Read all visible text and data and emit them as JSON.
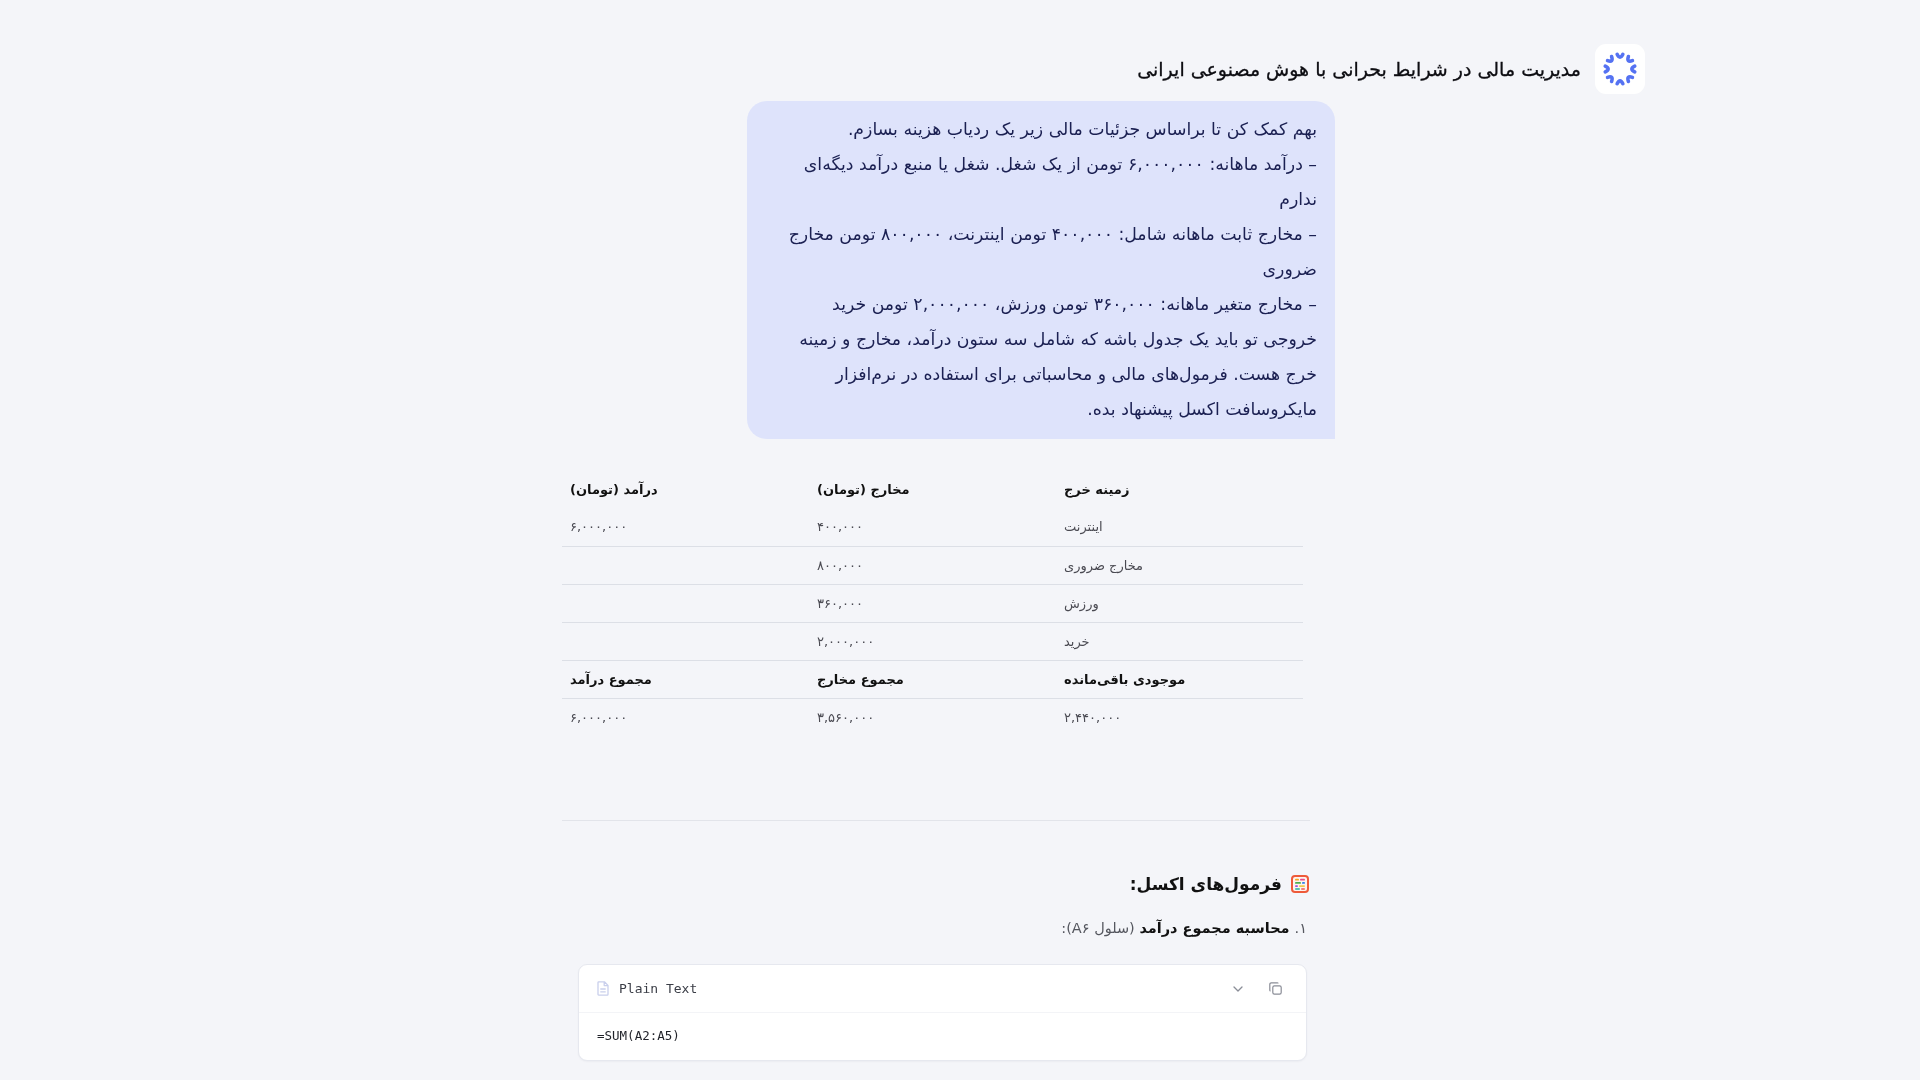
{
  "header": {
    "title": "مدیریت مالی در شرایط بحرانی با هوش مصنوعی ایرانی"
  },
  "user_message": {
    "paragraphs": [
      "بهم کمک کن تا براساس جزئیات مالی زیر یک ردیاب هزینه بسازم.",
      "– درآمد ماهانه: ۶,۰۰۰,۰۰۰ تومن از یک شغل. شغل یا منبع درآمد دیگه‌ای ندارم",
      "– مخارج ثابت ماهانه شامل: ۴۰۰,۰۰۰ تومن اینترنت، ۸۰۰,۰۰۰ تومن مخارج ضروری",
      "– مخارج متغیر ماهانه: ۳۶۰,۰۰۰ تومن ورزش، ۲,۰۰۰,۰۰۰ تومن خرید",
      "خروجی تو باید یک جدول باشه که شامل سه ستون درآمد، مخارج و زمینه خرج هست. فرمول‌های مالی و محاسباتی برای استفاده در نرم‌افزار مایکروسافت اکسل پیشنهاد بده."
    ]
  },
  "table": {
    "columns": [
      "زمینه خرج",
      "مخارج (تومان)",
      "درآمد (تومان)"
    ],
    "rows": [
      {
        "kind": "value",
        "category": "اینترنت",
        "expenses": "۴۰۰,۰۰۰",
        "income": "۶,۰۰۰,۰۰۰"
      },
      {
        "kind": "value",
        "category": "مخارج ضروری",
        "expenses": "۸۰۰,۰۰۰"
      },
      {
        "kind": "value",
        "category": "ورزش",
        "expenses": "۳۶۰,۰۰۰"
      },
      {
        "kind": "value",
        "category": "خرید",
        "expenses": "۲,۰۰۰,۰۰۰"
      },
      {
        "kind": "heading",
        "category": "موجودی باقی‌مانده",
        "expenses": "مجموع مخارج",
        "income": "مجموع درآمد"
      },
      {
        "kind": "value",
        "category": "۲,۴۴۰,۰۰۰",
        "expenses": "۳,۵۶۰,۰۰۰",
        "income": "۶,۰۰۰,۰۰۰"
      }
    ]
  },
  "formulas": {
    "heading": "فرمول‌های اکسل:",
    "items": [
      {
        "number": "۱.",
        "text": "**محاسبه مجموع درآمد** (سلول A۶):",
        "code_block": {
          "language": "Plain Text",
          "code": "=SUM(A2:A5)"
        }
      }
    ]
  }
}
